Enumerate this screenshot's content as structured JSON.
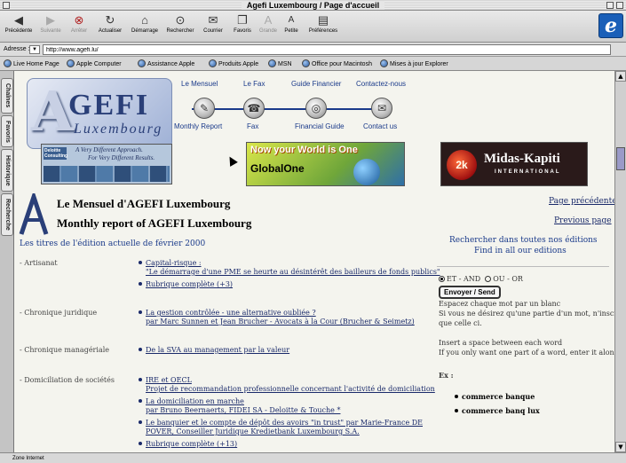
{
  "window": {
    "title": "Agefi Luxembourg / Page d'accueil"
  },
  "toolbar": {
    "buttons": [
      {
        "label": "Précédente",
        "icon": "back-arrow-icon",
        "enabled": true
      },
      {
        "label": "Suivante",
        "icon": "forward-arrow-icon",
        "enabled": false
      },
      {
        "label": "Arrêter",
        "icon": "stop-icon",
        "enabled": false
      },
      {
        "label": "Actualiser",
        "icon": "refresh-icon",
        "enabled": true
      },
      {
        "label": "Démarrage",
        "icon": "home-icon",
        "enabled": true
      },
      {
        "label": "Rechercher",
        "icon": "search-icon",
        "enabled": true
      },
      {
        "label": "Courrier",
        "icon": "mail-icon",
        "enabled": true
      },
      {
        "label": "Favoris",
        "icon": "favorites-icon",
        "enabled": true
      },
      {
        "label": "Grande",
        "icon": "font-larger-icon",
        "enabled": false
      },
      {
        "label": "Petite",
        "icon": "font-smaller-icon",
        "enabled": true
      },
      {
        "label": "Préférences",
        "icon": "preferences-icon",
        "enabled": true
      }
    ]
  },
  "address": {
    "label": "Adresse :",
    "value": "http://www.agefi.lu/"
  },
  "favorites": [
    "Live Home Page",
    "Apple Computer",
    "Assistance Apple",
    "Produits Apple",
    "MSN",
    "Office pour Macintosh",
    "Mises à jour Explorer"
  ],
  "side_tabs": [
    "Chaînes",
    "Favoris",
    "Historique",
    "Recherche"
  ],
  "logo": {
    "initial": "A",
    "word": "GEFI",
    "sub": "Luxembourg"
  },
  "nav": {
    "top": [
      "Le Mensuel",
      "Le Fax",
      "Guide Financier",
      "Contactez-nous"
    ],
    "bottom": [
      "Monthly Report",
      "Fax",
      "Financial Guide",
      "Contact us"
    ]
  },
  "banners": {
    "deloitte": {
      "brand": "Deloitte Consulting",
      "tagline1": "A Very Different Approach.",
      "tagline2": "For Very Different Results."
    },
    "globalone": {
      "headline": "Now your World is One",
      "brand": "GlobalOne"
    },
    "midas": {
      "name": "Midas-Kapiti",
      "sub": "INTERNATIONAL"
    }
  },
  "header": {
    "title_fr": "Le Mensuel d'AGEFI Luxembourg",
    "title_en": "Monthly report of AGEFI Luxembourg",
    "prev_fr": "Page précédente",
    "prev_en": "Previous page",
    "section": "Les titres de l'édition actuelle de février 2000"
  },
  "categories": [
    {
      "name": "- Artisanat",
      "items": [
        "Capital-risque :",
        "\"Le démarrage d'une PME se heurte au désintérêt des bailleurs de fonds publics\"",
        "Rubrique complète (+3)"
      ]
    },
    {
      "name": "- Chronique juridique",
      "items": [
        "La gestion contrôlée - une alternative oubliée ?",
        "par Marc Sunnen et Jean Brucher - Avocats à la Cour (Brucher & Seimetz)"
      ]
    },
    {
      "name": "- Chronique managériale",
      "items": [
        "De la SVA au management par la valeur"
      ]
    },
    {
      "name": "- Domiciliation de sociétés",
      "items": [
        "IRE et OECL",
        "Projet de recommandation professionnelle concernant l'activité de domiciliation",
        "La domiciliation en marche",
        "par Bruno Beernaerts, FIDEI SA - Deloitte & Touche *",
        "Le banquier et le compte de dépôt des avoirs \"in trust\" par Marie-France DE",
        "POVER, Conseiller Juridique Kredietbank Luxembourg S.A.",
        "Rubrique complète (+13)"
      ]
    }
  ],
  "search": {
    "title_fr": "Rechercher dans toutes nos éditions",
    "title_en": "Find in all our editions",
    "option_and": "ET - AND",
    "option_or": "OU - OR",
    "button": "Envoyer / Send",
    "help_fr_1": "Espacez chaque mot par un blanc",
    "help_fr_2": "Si vous ne désirez qu'une partie d'un mot, n'inscriv",
    "help_fr_3": "que celle ci.",
    "help_en_1": "Insert a space between each word",
    "help_en_2": "If you only want one part of a word, enter it alone",
    "ex_label": "Ex :",
    "examples": [
      "commerce banque",
      "commerce banq lux"
    ]
  },
  "status": {
    "text": "Zone Internet"
  }
}
